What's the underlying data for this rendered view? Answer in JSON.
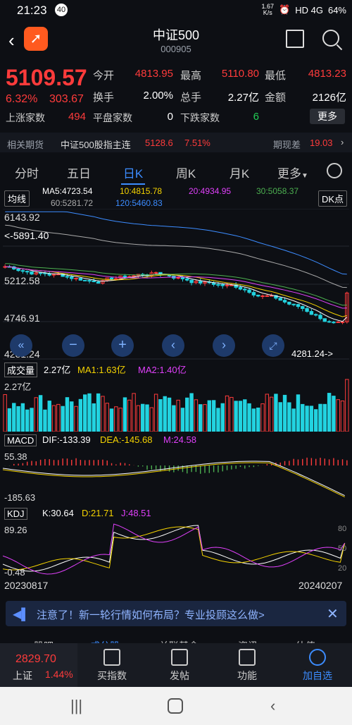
{
  "status": {
    "time": "21:23",
    "badge": "40",
    "speed_top": "1.67",
    "speed_bottom": "K/s",
    "net": "HD 4G",
    "battery": "64%"
  },
  "header": {
    "title": "中证500",
    "code": "000905"
  },
  "quote": {
    "price": "5109.57",
    "pct": "6.32%",
    "change": "303.67",
    "open_label": "今开",
    "open": "4813.95",
    "high_label": "最高",
    "high": "5110.80",
    "low_label": "最低",
    "low": "4813.23",
    "turnover_label": "换手",
    "turnover": "2.00%",
    "volume_label": "总手",
    "volume": "2.27亿",
    "amount_label": "金额",
    "amount": "2126亿",
    "up_label": "上涨家数",
    "up": "494",
    "flat_label": "平盘家数",
    "flat": "0",
    "down_label": "下跌家数",
    "down": "6",
    "more": "更多"
  },
  "futures": {
    "label": "相关期货",
    "name": "中证500股指主连",
    "price": "5128.6",
    "pct": "7.51%",
    "spread_label": "期现差",
    "spread": "19.03"
  },
  "tabs": [
    {
      "label": "分时"
    },
    {
      "label": "五日"
    },
    {
      "label": "日K"
    },
    {
      "label": "周K"
    },
    {
      "label": "月K"
    },
    {
      "label": "更多"
    }
  ],
  "kline": {
    "ma_button": "均线",
    "dk_button": "DK点",
    "ma5": "MA5:4723.54",
    "ma10": "10:4815.78",
    "ma20": "20:4934.95",
    "ma30": "30:5058.37",
    "ma60": "60:5281.72",
    "ma120": "120:5460.83",
    "y_top": "6143.92",
    "y_2": "5212.58",
    "y_3": "4746.91",
    "y_bot": "4281.24",
    "hi_label": "5891.40",
    "lo_label": "4281.24->",
    "colors": {
      "ma5": "#ffffff",
      "ma10": "#f5d300",
      "ma20": "#e040fb",
      "ma30": "#4caf50",
      "ma60": "#aaaaaa",
      "ma120": "#3c8cff",
      "up": "#ff3b3b",
      "down": "#22d3e0"
    }
  },
  "volume": {
    "button": "成交量",
    "vol": "2.27亿",
    "ma1": "MA1:1.63亿",
    "ma2": "MA2:1.40亿",
    "y_top": "2.27亿"
  },
  "macd": {
    "button": "MACD",
    "dif": "DIF:-133.39",
    "dea": "DEA:-145.68",
    "m": "M:24.58",
    "y_top": "55.38",
    "y_bot": "-185.63"
  },
  "kdj": {
    "button": "KDJ",
    "k": "K:30.64",
    "d": "D:21.71",
    "j": "J:48.51",
    "y_top": "89.26",
    "y_bot": "-0.48",
    "r_top": "80",
    "r_mid": "50",
    "r_bot": "20"
  },
  "dates": {
    "start": "20230817",
    "end": "20240207"
  },
  "notice": {
    "text": "注意了！新一轮行情如何布局？专业投顾这么做>"
  },
  "hidden_tabs": {
    "a": "股吧",
    "b": "成分股",
    "c": "关联基金",
    "d": "资讯",
    "e": "估值"
  },
  "bottom": {
    "index_value": "2829.70",
    "index_name": "上证",
    "index_pct": "1.44%",
    "items": [
      {
        "label": "买指数"
      },
      {
        "label": "发帖"
      },
      {
        "label": "功能"
      },
      {
        "label": "加自选"
      }
    ]
  }
}
